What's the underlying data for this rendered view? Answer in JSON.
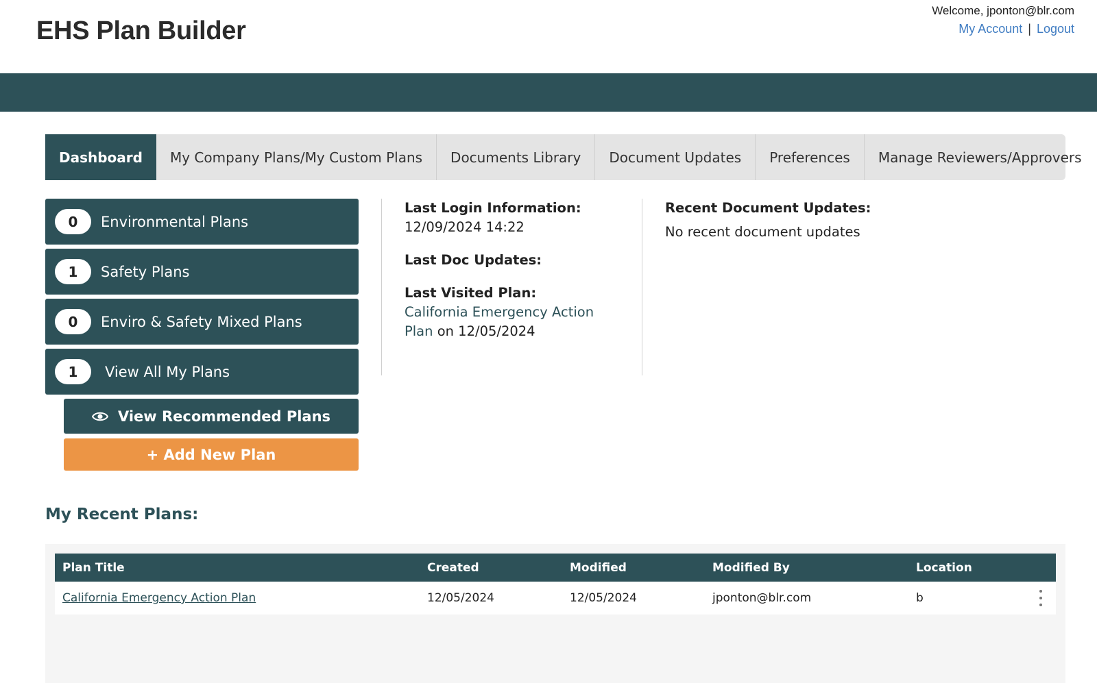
{
  "header": {
    "title": "EHS Plan Builder",
    "welcome": "Welcome, jponton@blr.com",
    "my_account": "My Account",
    "separator": "|",
    "logout": "Logout"
  },
  "tabs": [
    {
      "label": "Dashboard",
      "active": true
    },
    {
      "label": "My Company Plans/My Custom Plans"
    },
    {
      "label": "Documents Library"
    },
    {
      "label": "Document Updates"
    },
    {
      "label": "Preferences"
    },
    {
      "label": "Manage Reviewers/Approvers"
    }
  ],
  "plans": [
    {
      "count": "0",
      "label": "Environmental Plans"
    },
    {
      "count": "1",
      "label": "Safety Plans"
    },
    {
      "count": "0",
      "label": "Enviro & Safety Mixed Plans"
    },
    {
      "count": "1",
      "label": "View All My Plans"
    }
  ],
  "actions": {
    "recommended": "View Recommended Plans",
    "add_plan": "+ Add New Plan"
  },
  "info": {
    "last_login_label": "Last Login Information:",
    "last_login_value": "12/09/2024 14:22",
    "last_doc_updates_label": "Last Doc Updates:",
    "last_visited_label": "Last Visited Plan:",
    "last_visited_plan": "California Emergency Action Plan",
    "last_visited_date": " on 12/05/2024"
  },
  "updates": {
    "label": "Recent Document Updates:",
    "empty": "No recent document updates"
  },
  "recent": {
    "title": "My Recent Plans:",
    "columns": [
      "Plan Title",
      "Created",
      "Modified",
      "Modified By",
      "Location"
    ],
    "rows": [
      {
        "title": "California Emergency Action Plan",
        "created": "12/05/2024",
        "modified": "12/05/2024",
        "modified_by": "jponton@blr.com",
        "location": "b"
      }
    ]
  },
  "colors": {
    "primary": "#2d5158",
    "accent": "#ec9545",
    "link": "#3f7cc2"
  }
}
